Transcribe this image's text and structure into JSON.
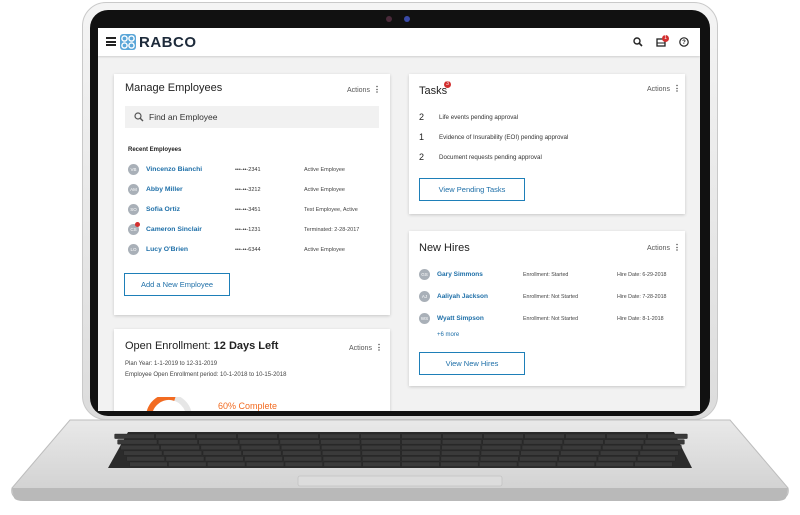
{
  "app": {
    "brand": "RABCO"
  },
  "header": {
    "notification_count": "1"
  },
  "manage_employees": {
    "title": "Manage Employees",
    "actions_label": "Actions",
    "search_placeholder": "Find an Employee",
    "recent_label": "Recent Employees",
    "employees": [
      {
        "initials": "VB",
        "name": "Vincenzo Bianchi",
        "ssn": "•••-••-2341",
        "status": "Active Employee"
      },
      {
        "initials": "AM",
        "name": "Abby Miller",
        "ssn": "•••-••-3212",
        "status": "Active Employee"
      },
      {
        "initials": "SO",
        "name": "Sofia Ortiz",
        "ssn": "•••-••-3451",
        "status": "Test Employee, Active"
      },
      {
        "initials": "CS",
        "name": "Cameron Sinclair",
        "ssn": "•••-••-1231",
        "status": "Terminated: 2-28-2017"
      },
      {
        "initials": "LO",
        "name": "Lucy O'Brien",
        "ssn": "•••-••-6344",
        "status": "Active Employee"
      }
    ],
    "add_button": "Add a New Employee"
  },
  "tasks": {
    "title": "Tasks",
    "badge": "3",
    "actions_label": "Actions",
    "items": [
      {
        "count": "2",
        "text": "Life events pending approval"
      },
      {
        "count": "1",
        "text": "Evidence of Insurability (EOI) pending approval"
      },
      {
        "count": "2",
        "text": "Document requests pending approval"
      }
    ],
    "view_button": "View Pending Tasks"
  },
  "new_hires": {
    "title": "New Hires",
    "actions_label": "Actions",
    "hires": [
      {
        "initials": "GS",
        "name": "Gary Simmons",
        "enrollment": "Enrollment: Started",
        "hire_date": "Hire Date: 6-29-2018"
      },
      {
        "initials": "AJ",
        "name": "Aaliyah Jackson",
        "enrollment": "Enrollment: Not Started",
        "hire_date": "Hire Date: 7-28-2018"
      },
      {
        "initials": "WS",
        "name": "Wyatt Simpson",
        "enrollment": "Enrollment: Not Started",
        "hire_date": "Hire Date: 8-1-2018"
      }
    ],
    "more_link": "+6 more",
    "view_button": "View New Hires"
  },
  "open_enrollment": {
    "title_prefix": "Open Enrollment: ",
    "title_days": "12 Days Left",
    "actions_label": "Actions",
    "plan_year": "Plan Year: 1-1-2019 to 12-31-2019",
    "period": "Employee Open Enrollment period: 10-1-2018 to 10-15-2018",
    "progress_label": "60% Complete",
    "progress_fraction": 0.6
  },
  "colors": {
    "accent": "#1e6fa8",
    "badge": "#d32f2f",
    "progress": "#f26b21"
  }
}
